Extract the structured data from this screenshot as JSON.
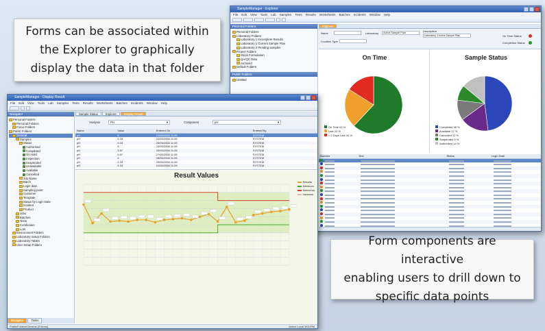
{
  "callouts": {
    "top": "Forms can be associated within\nthe Explorer to graphically\ndisplay the data in that folder",
    "bottom": "Form components are interactive\nenabling users to drill down to\nspecific data points"
  },
  "main_window": {
    "title": "SampleManager - Display Result",
    "menu": [
      "File",
      "Edit",
      "View",
      "Tools",
      "Lab",
      "Samples",
      "Tests",
      "Results",
      "Worksheets",
      "Batches",
      "Incidents",
      "Window",
      "Help"
    ],
    "nav_header": "Navigator",
    "tabs": [
      "Sample Status",
      "Explorer",
      "Display Result"
    ],
    "filter": {
      "analysis_label": "Analysis",
      "analysis_value": "PH",
      "component_label": "Component",
      "component_value": "pH"
    },
    "table_headers": [
      "Name",
      "Value",
      "Entered On",
      "Entered By"
    ],
    "rows": [
      [
        "pH",
        "6",
        "21/05/2008 11:05",
        "SYSTEM"
      ],
      [
        "pH",
        "5.33",
        "22/05/2008 11:05",
        "SYSTEM"
      ],
      [
        "pH",
        "5.33",
        "23/05/2008 11:05",
        "SYSTEM"
      ],
      [
        "pH",
        "6",
        "24/05/2008 11:05",
        "SYSTEM"
      ],
      [
        "pH",
        "5.57",
        "25/05/2008 11:05",
        "SYSTEM"
      ],
      [
        "pH",
        "5.57",
        "27/05/2008 11:05",
        "SYSTEM"
      ],
      [
        "pH",
        "6",
        "28/05/2008 11:05",
        "SYSTEM"
      ],
      [
        "pH",
        "5.33",
        "29/05/2008 11:05",
        "SYSTEM"
      ],
      [
        "pH",
        "5.33",
        "01/06/2008 11:05",
        "SYSTEM"
      ]
    ],
    "tree": [
      {
        "label": "Personal Folders",
        "level": 0
      },
      {
        "label": "Personal Folders",
        "level": 1
      },
      {
        "label": "Focus Folders",
        "level": 1
      },
      {
        "label": "Public Folders",
        "level": 0
      },
      {
        "label": "General",
        "level": 1
      },
      {
        "label": "Samples",
        "level": 2
      },
      {
        "label": "Status",
        "level": 3
      },
      {
        "label": "Authorised",
        "level": 4
      },
      {
        "label": "Completed",
        "level": 4
      },
      {
        "label": "On Hold",
        "level": 4
      },
      {
        "label": "Inspection",
        "level": 4
      },
      {
        "label": "Suspended",
        "level": 4
      },
      {
        "label": "Unavailable",
        "level": 4
      },
      {
        "label": "Available",
        "level": 4
      },
      {
        "label": "Cancelled",
        "level": 4
      },
      {
        "label": "Job Name",
        "level": 3
      },
      {
        "label": "Batch",
        "level": 3
      },
      {
        "label": "Login date",
        "level": 3
      },
      {
        "label": "Sampling point",
        "level": 3
      },
      {
        "label": "Customer",
        "level": 3
      },
      {
        "label": "Template",
        "level": 3
      },
      {
        "label": "Status by Login Date",
        "level": 3
      },
      {
        "label": "Incident",
        "level": 3
      },
      {
        "label": "Product",
        "level": 3
      },
      {
        "label": "Jobs",
        "level": 2
      },
      {
        "label": "Batches",
        "level": 2
      },
      {
        "label": "Tests",
        "level": 2
      },
      {
        "label": "Certificates",
        "level": 2
      },
      {
        "label": "Lots",
        "level": 2
      },
      {
        "label": "Environment Folders",
        "level": 1
      },
      {
        "label": "Laboratory Setup Folders",
        "level": 1
      },
      {
        "label": "Laboratory Tables",
        "level": 1
      },
      {
        "label": "User Setup Folders",
        "level": 1
      }
    ],
    "bottom_tabs": [
      "Navigator",
      "Tasks"
    ],
    "status_left": "PublicFolders\\General (9 items)",
    "status_right": "Active  Local  5/01/PM"
  },
  "explorer_window": {
    "title": "SampleManager - Explorer",
    "tree": [
      "Personal Folders",
      "Personal Folders",
      "Laboratory Folders",
      "Laboratory 1 Incomplete Results",
      "Laboratory 1 Current Sample Plan",
      "Laboratory 2 Pending samples",
      "Project Folders",
      "Stock Formulation",
      "QA/QC Data",
      "Archived",
      "Default Folders"
    ],
    "public_folders": [
      "Public Folders",
      "Untitled"
    ],
    "tab": "Explorer",
    "form": {
      "name_label": "Name",
      "lab_label": "Laboratory",
      "lab_value": "Active Sample Plan",
      "desc_label": "Description",
      "desc_value": "Laboratory 1 Active Sample Plan",
      "location_label": "Location Type",
      "on_time": "On Time Status",
      "completion": "Completion Status"
    },
    "table_headers": [
      "Number",
      "Text",
      "Status",
      "Login Date"
    ]
  },
  "chart_data": [
    {
      "type": "line",
      "title": "Result Values",
      "legend": [
        "Results",
        "Minimum",
        "Maximum",
        "Variance"
      ],
      "legend_position": "right",
      "series": [
        {
          "name": "Results",
          "values": [
            7.5,
            5.2,
            6.4,
            5.4,
            5.5,
            5.4,
            5.6,
            5.6,
            5.3,
            5.6,
            5.7,
            5.8,
            5.6,
            6.0,
            6.3,
            5.4,
            7.2,
            5.3,
            5.5,
            6.2,
            6.4,
            6.6,
            6.7,
            6.9
          ]
        },
        {
          "name": "Minimum",
          "values": [
            4,
            4,
            4,
            4,
            4,
            4,
            4,
            4,
            4,
            4,
            4,
            4,
            4,
            4,
            4,
            5,
            5,
            5,
            5,
            5,
            5,
            5,
            5,
            5
          ]
        },
        {
          "name": "Maximum",
          "values": [
            9,
            9,
            9,
            9,
            9,
            9,
            9,
            9,
            9,
            9,
            9,
            9,
            9,
            9,
            9,
            8,
            8,
            8,
            8,
            8,
            8,
            8,
            8,
            8
          ]
        }
      ],
      "ylim": [
        0,
        10
      ],
      "grid": true
    },
    {
      "type": "pie",
      "title": "On Time",
      "slices": [
        {
          "label": "On Time",
          "value": 62,
          "color": "#1f7a2a"
        },
        {
          "label": "Late",
          "value": 22,
          "color": "#f0a02a"
        },
        {
          "label": "< 2 Days Late",
          "value": 16,
          "color": "#e02a22"
        }
      ]
    },
    {
      "type": "pie",
      "title": "Sample Status",
      "slices": [
        {
          "label": "Completed",
          "value": 48,
          "color": "#2a46b8"
        },
        {
          "label": "Available",
          "value": 17,
          "color": "#6a2a8a"
        },
        {
          "label": "Cancelled",
          "value": 12,
          "color": "#7a7a7a"
        },
        {
          "label": "Suspended",
          "value": 9,
          "color": "#2a8a2a"
        },
        {
          "label": "Authorised",
          "value": 14,
          "color": "#c0c0c0"
        }
      ]
    }
  ]
}
